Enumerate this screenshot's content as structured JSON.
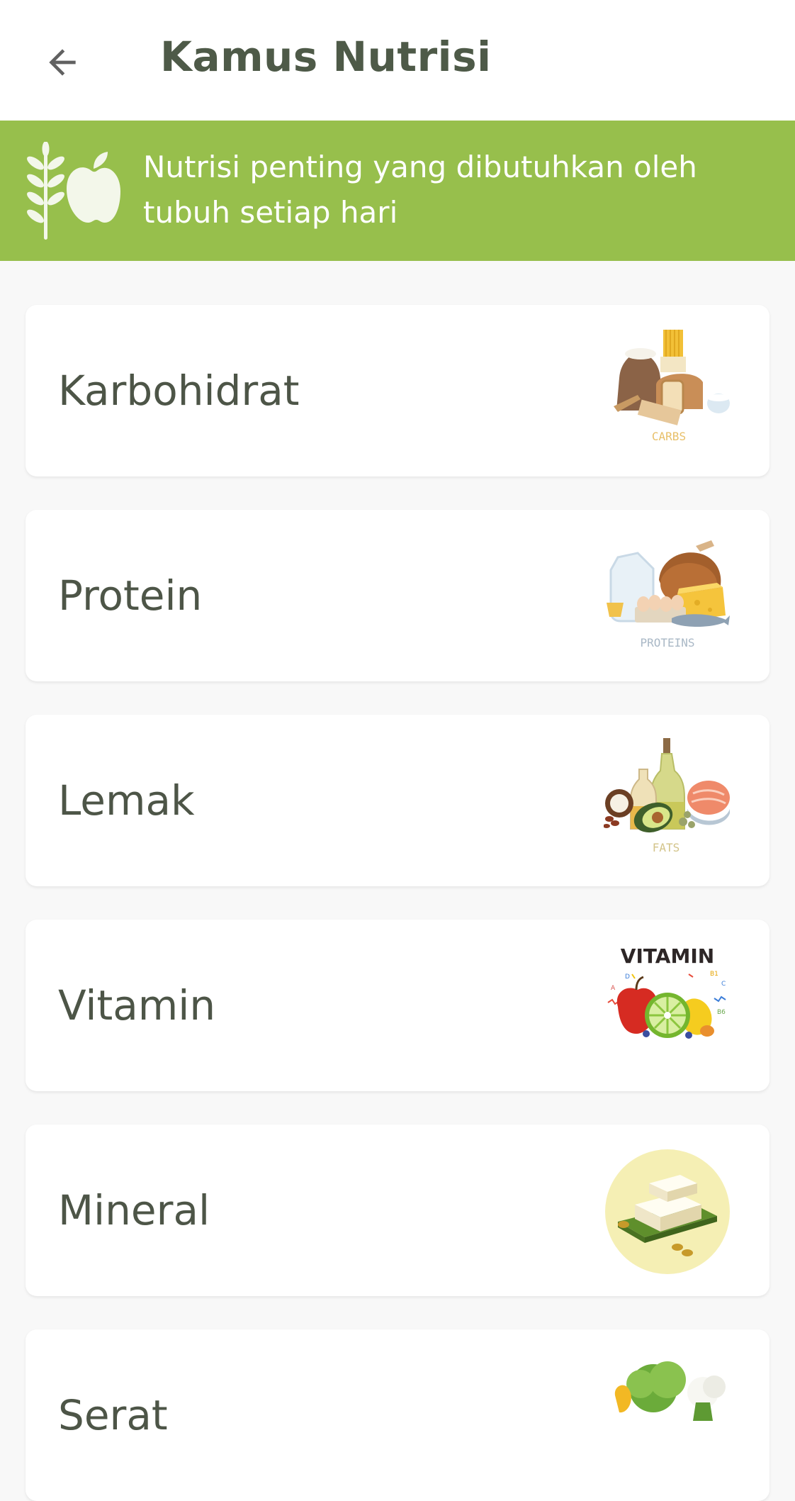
{
  "appbar": {
    "title": "Kamus Nutrisi",
    "back_icon": "arrow-left-icon"
  },
  "banner": {
    "icon": "wheat-apple-icon",
    "text": "Nutrisi penting yang dibutuhkan oleh tubuh setiap hari",
    "color": "#97bf4c"
  },
  "nutrients": [
    {
      "label": "Karbohidrat",
      "image_caption": "CARBS",
      "icon": "carbs-food-illustration"
    },
    {
      "label": "Protein",
      "image_caption": "PROTEINS",
      "icon": "protein-food-illustration"
    },
    {
      "label": "Lemak",
      "image_caption": "FATS",
      "icon": "fats-food-illustration"
    },
    {
      "label": "Vitamin",
      "image_caption": "VITAMIN",
      "icon": "vitamin-fruit-illustration"
    },
    {
      "label": "Mineral",
      "icon": "tofu-illustration"
    },
    {
      "label": "Serat",
      "icon": "vegetable-illustration"
    }
  ]
}
